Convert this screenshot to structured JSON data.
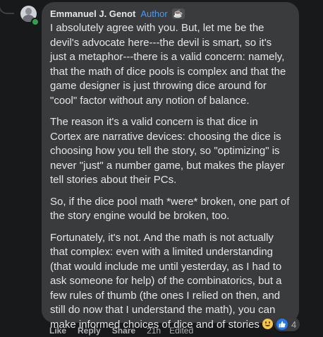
{
  "comment": {
    "author": "Emmanuel J. Genot",
    "author_badge": "Author",
    "badge_icon": "coffee-cup-icon",
    "paragraphs": [
      "I absolutely agree with you. But, let me be the devil's advocate here---the devil is smart, so it's just a metaphor---there is a valid concern: namely, that the math of dice pools is complex and that the game designer is just throwing dice around for \"cool\" factor without any notion of balance.",
      "The reason it's a valid concern is that dice in Cortex are narrative devices: choosing the dice is choosing how you tell the story, so \"optimizing\" is never \"just\" a number game, but makes the player tell stories about their PCs.",
      "So, if the dice pool math *were* broken, one part of the story engine would be broken, too.",
      "Fortunately, it's not. And the math is not actually that complex: even with a limited understanding (that would include me until yesterday, as I had to ask someone for help) of the combinatorics, but a few rules of thumb (the ones I relied on then, and still do now that I understand the math), you can make informed choices of dice and of stories"
    ],
    "trailing_emoji": "smiling-face-emoji",
    "reactions": {
      "icon": "like-icon",
      "count": "4",
      "color": "#2078f4"
    },
    "actions": {
      "like": "Like",
      "reply": "Reply",
      "share": "Share",
      "time": "21h",
      "edited": "Edited"
    }
  },
  "colors": {
    "background": "#18191a",
    "bubble": "#3a3b3c",
    "author_badge": "#4599ff",
    "online": "#31a24c"
  }
}
